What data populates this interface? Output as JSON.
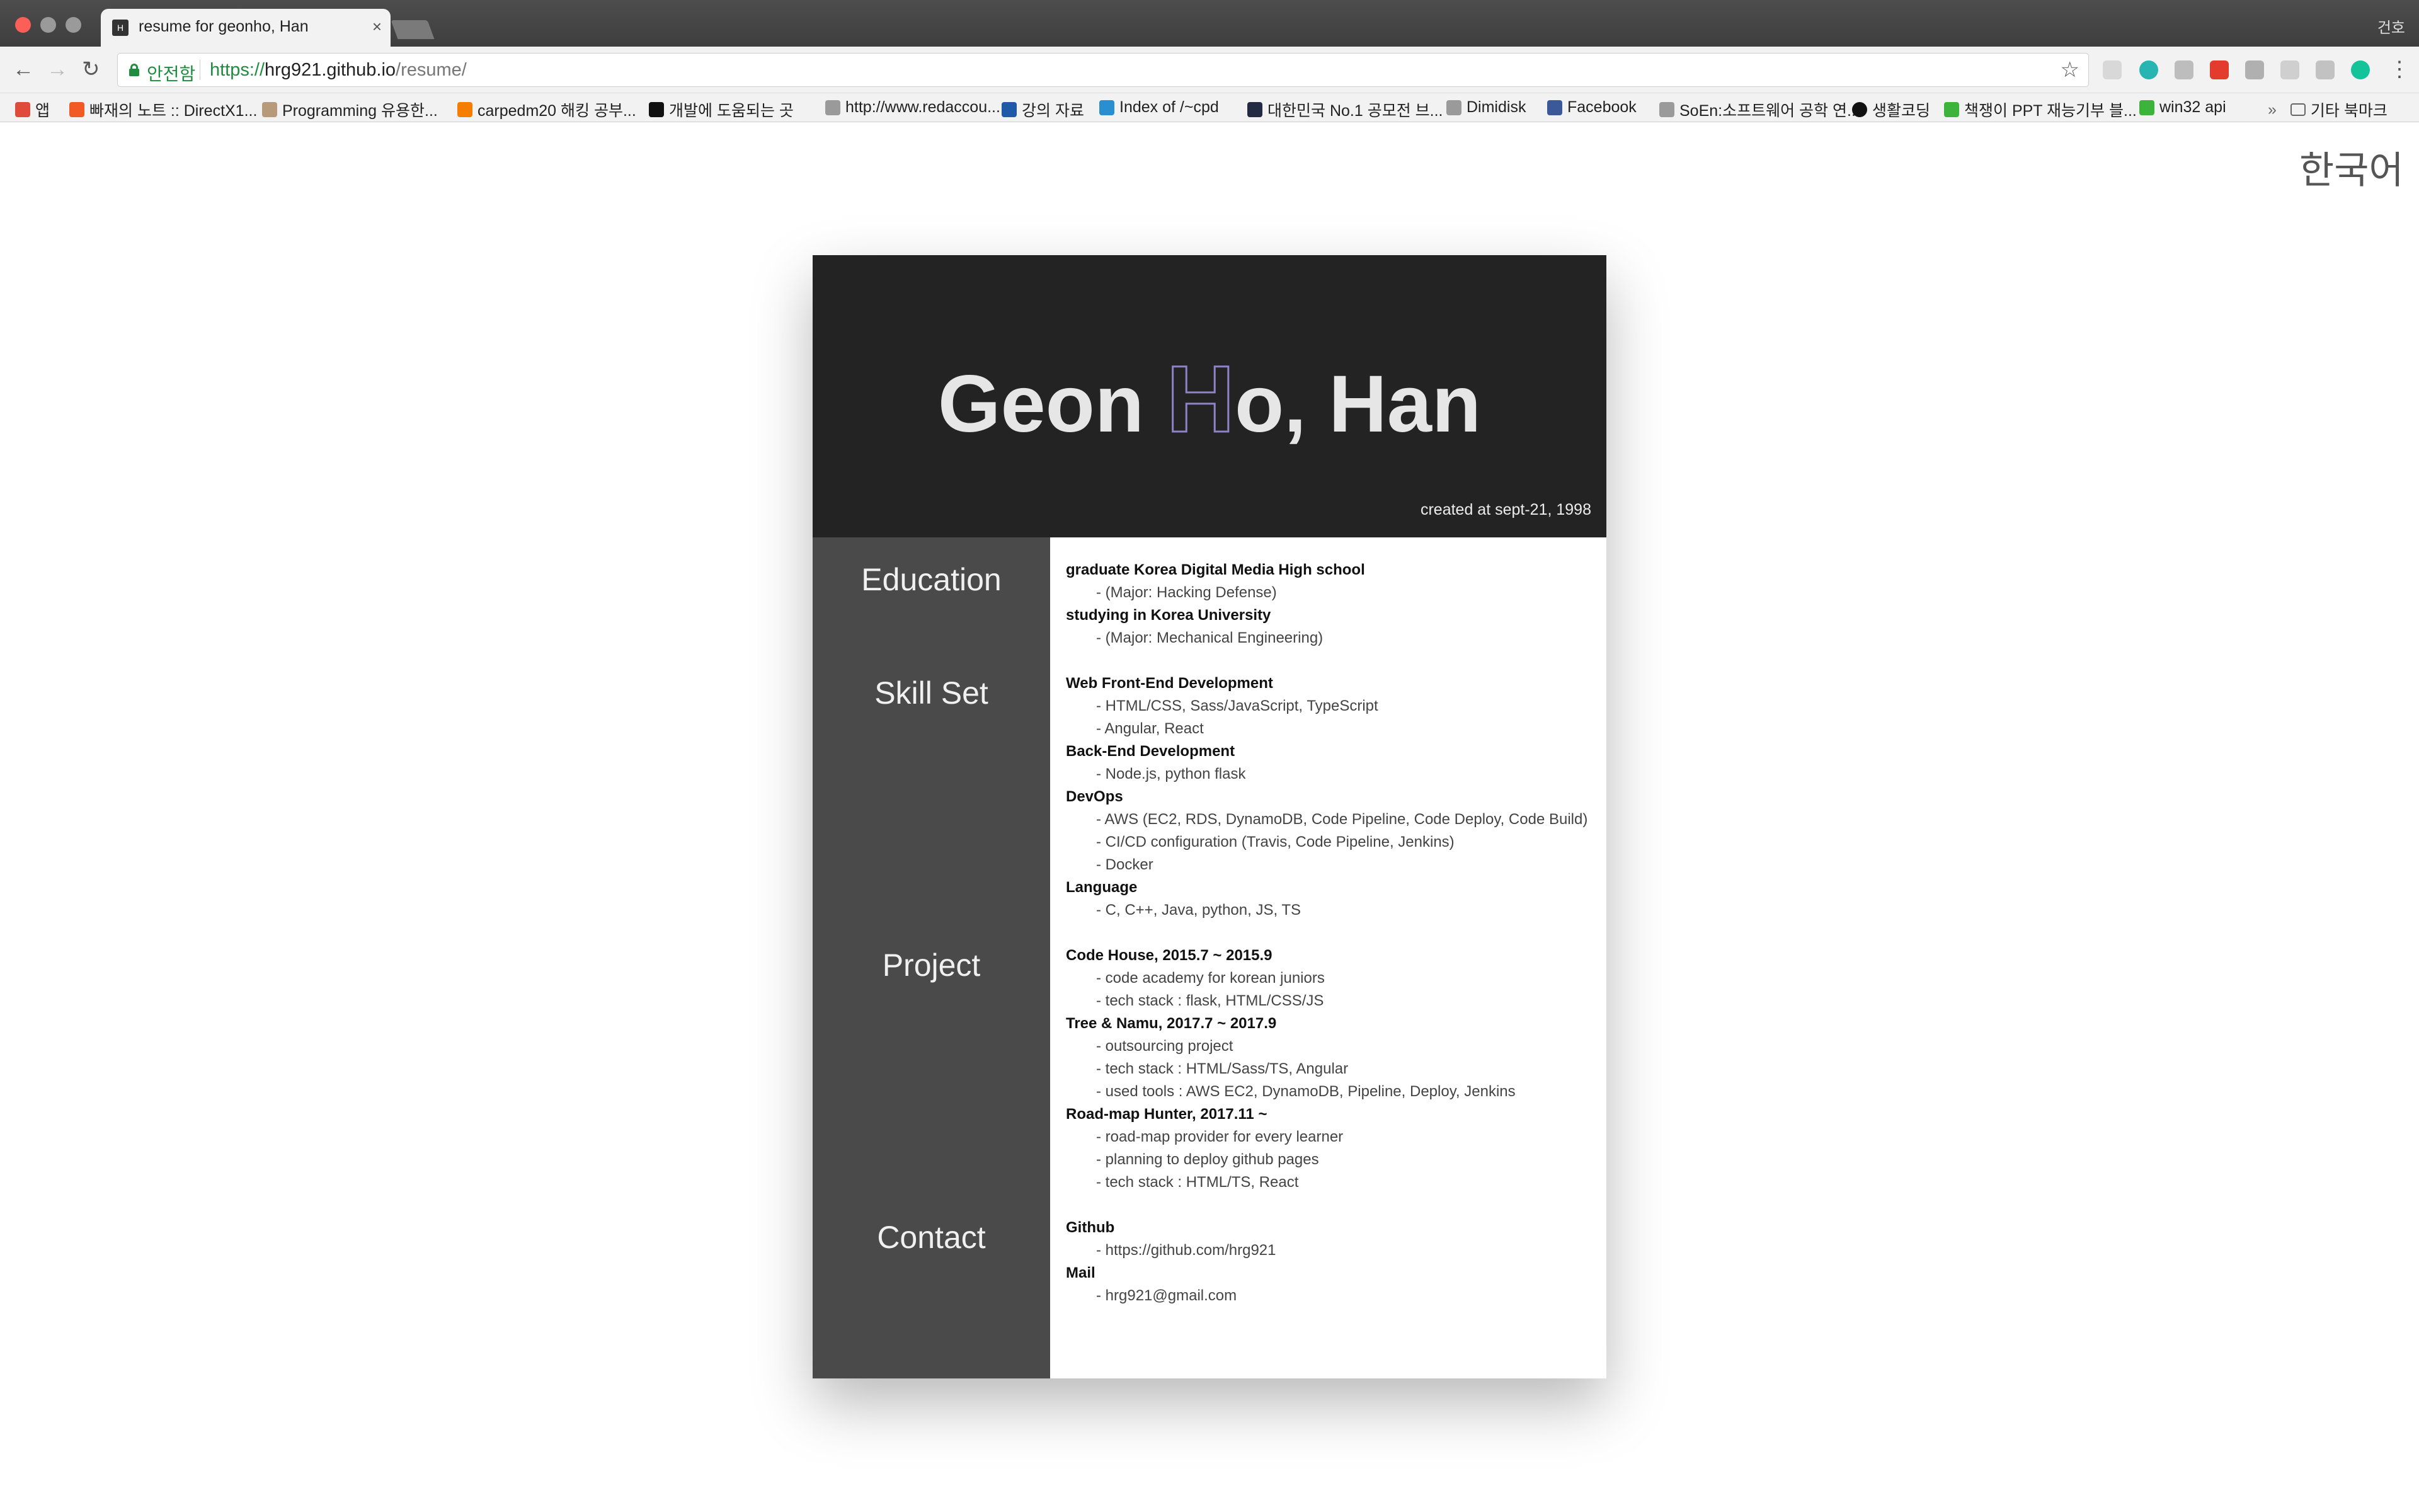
{
  "browser": {
    "tab_title": "resume for geonho, Han",
    "tab_favicon": "H",
    "profile_name": "건호",
    "security_label": "안전함",
    "url_scheme": "https://",
    "url_host": "hrg921.github.io",
    "url_path": "/resume/",
    "bookmarks": [
      {
        "label": "앱",
        "icon": "apps-grid-icon",
        "color": "#e04a3a"
      },
      {
        "label": "빠재의 노트 :: DirectX1...",
        "icon": "tistory-icon",
        "color": "#f15a24"
      },
      {
        "label": "Programming 유용한...",
        "icon": "pattern-icon",
        "color": "#b79a7a"
      },
      {
        "label": "carpedm20 해킹 공부...",
        "icon": "blogger-icon",
        "color": "#f57d00"
      },
      {
        "label": "개발에 도움되는 곳",
        "icon": "medium-icon",
        "color": "#111111"
      },
      {
        "label": "http://www.redaccou...",
        "icon": "page-icon",
        "color": "#9a9a9a"
      },
      {
        "label": "강의 자료",
        "icon": "cross-icon",
        "color": "#1e5aa8"
      },
      {
        "label": "Index of /~cpd",
        "icon": "diamond-icon",
        "color": "#2a8fd0"
      },
      {
        "label": "대한민국 No.1 공모전 브...",
        "icon": "d-icon",
        "color": "#222a44"
      },
      {
        "label": "Dimidisk",
        "icon": "page-icon",
        "color": "#9a9a9a"
      },
      {
        "label": "Facebook",
        "icon": "facebook-icon",
        "color": "#3b5998"
      },
      {
        "label": "SoEn:소프트웨어 공학 연...",
        "icon": "page-icon",
        "color": "#9a9a9a"
      },
      {
        "label": "생활코딩",
        "icon": "circle-icon",
        "color": "#111111"
      },
      {
        "label": "책쟁이 PPT 재능기부 블...",
        "icon": "blog-icon",
        "color": "#3cb43c"
      },
      {
        "label": "win32 api",
        "icon": "blog-icon",
        "color": "#3cb43c"
      }
    ],
    "more_bookmarks": "기타 북마크"
  },
  "page": {
    "language_toggle": "한국어",
    "name_before": "Geon ",
    "name_letter": "H",
    "name_after": "o, Han",
    "created": "created at sept-21, 1998",
    "sections": {
      "education": "Education",
      "skills": "Skill Set",
      "project": "Project",
      "contact": "Contact"
    },
    "lines": [
      {
        "type": "head",
        "text": "graduate Korea Digital Media High school"
      },
      {
        "type": "item",
        "text": "- (Major: Hacking Defense)"
      },
      {
        "type": "head",
        "text": "studying in Korea University"
      },
      {
        "type": "item",
        "text": "- (Major: Mechanical Engineering)"
      },
      {
        "type": "head",
        "text": "Web Front-End Development"
      },
      {
        "type": "item",
        "text": "- HTML/CSS, Sass/JavaScript, TypeScript"
      },
      {
        "type": "item",
        "text": "- Angular, React"
      },
      {
        "type": "head",
        "text": "Back-End Development"
      },
      {
        "type": "item",
        "text": "- Node.js, python flask"
      },
      {
        "type": "head",
        "text": "DevOps"
      },
      {
        "type": "item",
        "text": "- AWS (EC2, RDS, DynamoDB, Code Pipeline, Code Deploy, Code Build)"
      },
      {
        "type": "item",
        "text": "- CI/CD configuration (Travis, Code Pipeline, Jenkins)"
      },
      {
        "type": "item",
        "text": "- Docker"
      },
      {
        "type": "head",
        "text": "Language"
      },
      {
        "type": "item",
        "text": "- C, C++, Java, python, JS, TS"
      },
      {
        "type": "head",
        "text": "Code House, 2015.7 ~ 2015.9"
      },
      {
        "type": "item",
        "text": "- code academy for korean juniors"
      },
      {
        "type": "item",
        "text": "- tech stack : flask, HTML/CSS/JS"
      },
      {
        "type": "head",
        "text": "Tree & Namu, 2017.7 ~ 2017.9"
      },
      {
        "type": "item",
        "text": "- outsourcing project"
      },
      {
        "type": "item",
        "text": "- tech stack : HTML/Sass/TS, Angular"
      },
      {
        "type": "item",
        "text": "- used tools : AWS EC2, DynamoDB, Pipeline, Deploy, Jenkins"
      },
      {
        "type": "head",
        "text": "Road-map Hunter, 2017.11 ~"
      },
      {
        "type": "item",
        "text": "- road-map provider for every learner"
      },
      {
        "type": "item",
        "text": "- planning to deploy github pages"
      },
      {
        "type": "item",
        "text": "- tech stack : HTML/TS, React"
      },
      {
        "type": "head",
        "text": "Github"
      },
      {
        "type": "item",
        "text": "- https://github.com/hrg921"
      },
      {
        "type": "head",
        "text": "Mail"
      },
      {
        "type": "item",
        "text": "- hrg921@gmail.com"
      }
    ]
  }
}
